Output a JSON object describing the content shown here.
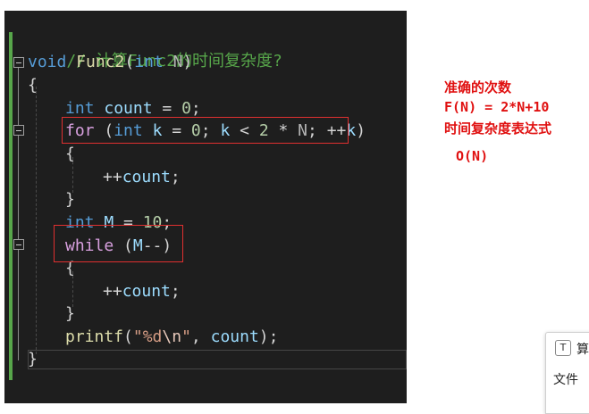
{
  "code": {
    "comment": "// 计算Func2的时间复杂度?",
    "sig_kw": "void",
    "sig_fn": "Func2",
    "sig_open": "(",
    "sig_param_kw": "int",
    "sig_param": "N",
    "sig_close": ")",
    "open_brace": "{",
    "l_count_kw": "int",
    "l_count_var": "count",
    "l_count_eq": " = ",
    "l_count_val": "0",
    "semi": ";",
    "for_kw": "for",
    "for_open": " (",
    "for_int": "int",
    "for_k1": "k",
    "for_eq": " = ",
    "for_zero": "0",
    "for_semi1": "; ",
    "for_k2": "k",
    "for_lt": " < ",
    "for_two": "2",
    "for_mul": " * ",
    "for_n": "N",
    "for_semi2": "; ",
    "for_inc": "++",
    "for_k3": "k",
    "for_close": ")",
    "inner_open": "{",
    "inc_count_op": "++",
    "inc_count_var": "count",
    "inner_close": "}",
    "m_kw": "int",
    "m_var": "M",
    "m_eq": " = ",
    "m_val": "10",
    "while_kw": "while",
    "while_open": " (",
    "while_var": "M",
    "while_dec": "--",
    "while_close": ")",
    "printf_fn": "printf",
    "printf_open": "(",
    "printf_str1": "\"%d",
    "printf_esc": "\\n",
    "printf_str2": "\"",
    "printf_comma": ", ",
    "printf_var": "count",
    "printf_close": ");",
    "close_brace": "}"
  },
  "notes": {
    "line1": "准确的次数",
    "line2": "F(N) = 2*N+10",
    "line3": "时间复杂度表达式",
    "line4": "O(N)"
  },
  "popup": {
    "icon": "T",
    "title": "算",
    "menu_file": "文件"
  },
  "colors": {
    "editor_bg": "#1e1e1e",
    "keyword": "#569cd6",
    "control": "#d8a0df",
    "function": "#dcdcaa",
    "variable": "#9cdcfe",
    "number": "#b5cea8",
    "comment": "#57a64a",
    "string": "#d69d85",
    "annotation": "#e01010"
  },
  "icons": [
    "fold-collapse-icon",
    "text-format-icon"
  ]
}
